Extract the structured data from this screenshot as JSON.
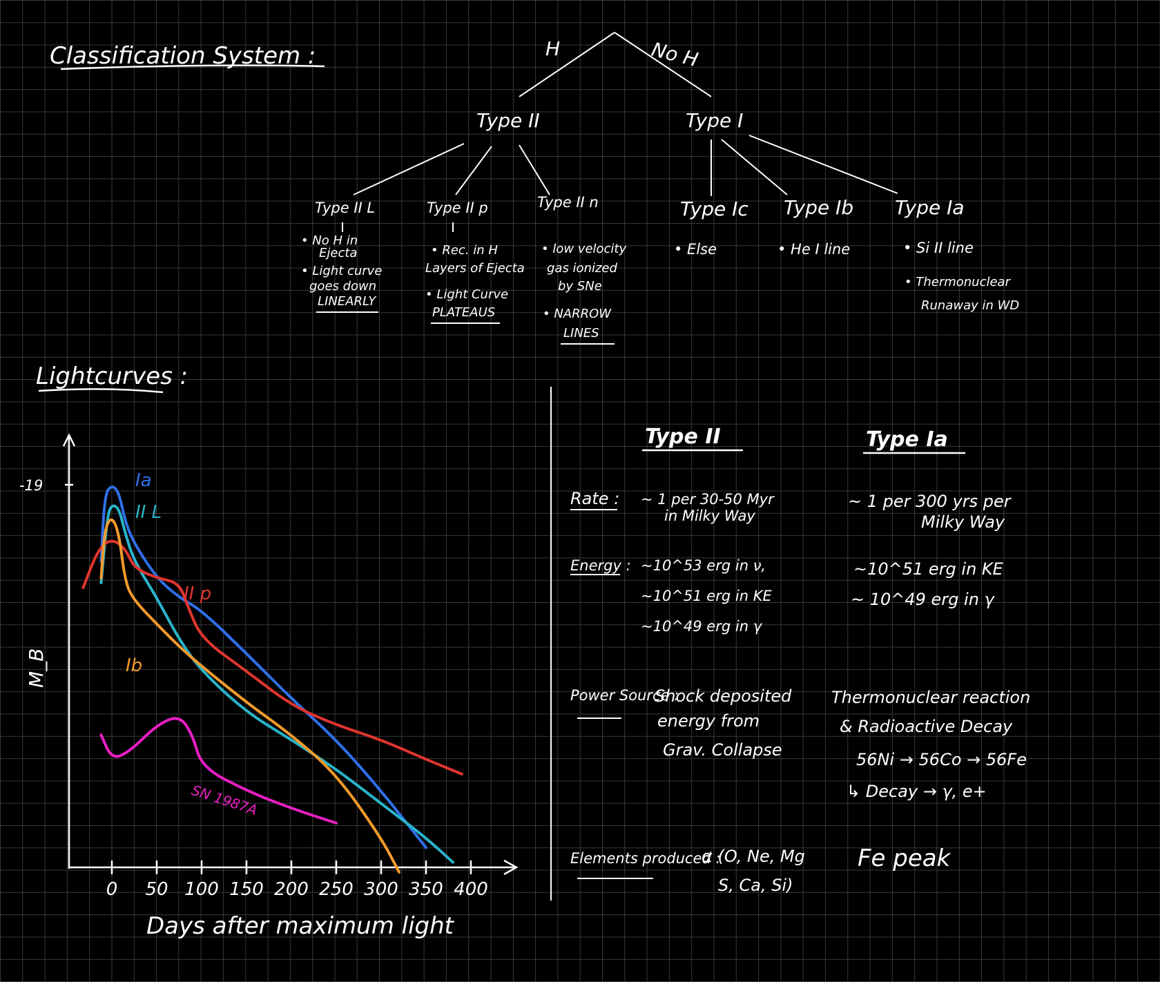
{
  "title": "Classification System :",
  "tree": {
    "h": "H",
    "no_h": "No H",
    "type2": "Type II",
    "type1": "Type I",
    "leaves": [
      {
        "label": "Type II L",
        "notes": [
          "• No H in",
          "Ejecta",
          "• Light curve",
          "goes down",
          "LINEARLY"
        ]
      },
      {
        "label": "Type II p",
        "notes": [
          "• Rec. in H",
          "Layers of Ejecta",
          "• Light Curve",
          "PLATEAUS"
        ]
      },
      {
        "label": "Type II n",
        "notes": [
          "• low velocity",
          "gas ionized",
          "by SNe",
          "• NARROW",
          "LINES"
        ]
      },
      {
        "label": "Type Ic",
        "notes": [
          "• Else"
        ]
      },
      {
        "label": "Type Ib",
        "notes": [
          "• He I line"
        ]
      },
      {
        "label": "Type Ia",
        "notes": [
          "• Si II line",
          "• Thermonuclear",
          "Runaway in WD"
        ]
      }
    ]
  },
  "lightcurves_title": "Lightcurves :",
  "chart_data": {
    "type": "line",
    "xlabel": "Days after maximum light",
    "ylabel": "M_B",
    "y_tick": "-19",
    "x_ticks": [
      "0",
      "50",
      "100",
      "150",
      "200",
      "250",
      "300",
      "350",
      "400"
    ],
    "xlim": [
      -50,
      460
    ],
    "series": [
      {
        "name": "Ia",
        "color": "#2f6fe8",
        "x": [
          -12,
          -8,
          0,
          8,
          15,
          25,
          50,
          75,
          100,
          150,
          200,
          250,
          300,
          350
        ],
        "y": [
          0.78,
          0.1,
          0.0,
          0.08,
          0.38,
          0.6,
          0.95,
          1.15,
          1.28,
          1.72,
          2.18,
          2.6,
          3.12,
          3.7
        ]
      },
      {
        "name": "II L",
        "color": "#29b3c9",
        "x": [
          -12,
          -5,
          0,
          8,
          15,
          25,
          50,
          75,
          100,
          150,
          200,
          250,
          300,
          350,
          380
        ],
        "y": [
          1.0,
          0.32,
          0.2,
          0.24,
          0.5,
          0.78,
          1.15,
          1.58,
          1.9,
          2.32,
          2.6,
          2.9,
          3.25,
          3.6,
          3.85
        ]
      },
      {
        "name": "II p",
        "color": "#e0352f",
        "x": [
          -32,
          -15,
          0,
          15,
          25,
          50,
          75,
          85,
          100,
          150,
          200,
          250,
          300,
          350,
          390
        ],
        "y": [
          1.05,
          0.65,
          0.55,
          0.65,
          0.85,
          0.95,
          1.0,
          1.25,
          1.57,
          1.9,
          2.25,
          2.45,
          2.6,
          2.8,
          2.95
        ]
      },
      {
        "name": "Ib",
        "color": "#f39a2b",
        "x": [
          -12,
          -8,
          0,
          8,
          15,
          25,
          50,
          75,
          100,
          150,
          200,
          250,
          300,
          320
        ],
        "y": [
          0.95,
          0.45,
          0.32,
          0.5,
          1.0,
          1.18,
          1.42,
          1.65,
          1.85,
          2.22,
          2.55,
          2.95,
          3.6,
          3.95
        ]
      },
      {
        "name": "SN 1987A",
        "color": "#e81fc2",
        "x": [
          -12,
          0,
          20,
          50,
          75,
          90,
          100,
          150,
          200,
          250
        ],
        "y": [
          2.55,
          2.8,
          2.72,
          2.45,
          2.35,
          2.55,
          2.88,
          3.12,
          3.3,
          3.45
        ]
      }
    ]
  },
  "comparison": {
    "col1": "Type II",
    "col2": "Type Ia",
    "rows": [
      {
        "label": "Rate :",
        "type2": [
          "~ 1 per 30-50 Myr",
          "in Milky Way"
        ],
        "type1a": [
          "~ 1 per 300 yrs per",
          "Milky Way"
        ]
      },
      {
        "label": "Energy :",
        "type2": [
          "~10^53 erg in ν,",
          "~10^51 erg in KE",
          "~10^49 erg in γ"
        ],
        "type1a": [
          "~10^51 erg in KE",
          "~ 10^49 erg in γ"
        ]
      },
      {
        "label": "Power Source :",
        "type2": [
          "Shock deposited",
          "energy from",
          "Grav. Collapse"
        ],
        "type1a": [
          "Thermonuclear reaction",
          "& Radioactive Decay",
          "56Ni → 56Co → 56Fe",
          "↳ Decay → γ, e+"
        ]
      },
      {
        "label": "Elements produced :",
        "type2": [
          "α (O, Ne, Mg",
          "S, Ca, Si)"
        ],
        "type1a": [
          "Fe peak"
        ]
      }
    ]
  },
  "colors": {
    "background": "#000000",
    "grid": "#3a3a3a",
    "ink": "#ffffff"
  }
}
